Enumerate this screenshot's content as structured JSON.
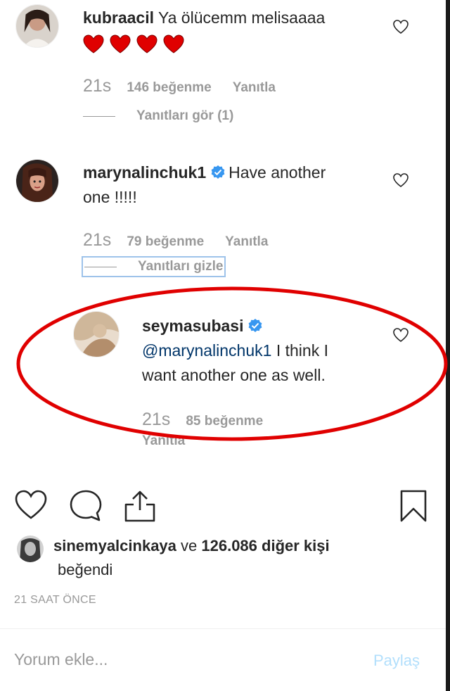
{
  "comments": [
    {
      "username": "kubraacil",
      "text": "Ya ölücemm melisaaaa",
      "verified": false,
      "emoji": "red-heart x4",
      "time": "21s",
      "likes": "146 beğenme",
      "reply_label": "Yanıtla",
      "replies_toggle": "Yanıtları gör (1)"
    },
    {
      "username": "marynalinchuk1",
      "text_line1": "Have another",
      "text_line2": "one !!!!!",
      "verified": true,
      "time": "21s",
      "likes": "79 beğenme",
      "reply_label": "Yanıtla",
      "replies_toggle": "Yanıtları gizle"
    },
    {
      "username": "seymasubasi",
      "mention": "@marynalinchuk1",
      "text_line1": " I think I",
      "text_line2": "want another one as well.",
      "verified": true,
      "time": "21s",
      "likes": "85 beğenme",
      "reply_label": "Yanıtla"
    }
  ],
  "liked_by": {
    "user": "sinemyalcinkaya",
    "connector": " ve ",
    "others": "126.086 diğer kişi",
    "suffix": "beğendi"
  },
  "timestamp": "21 SAAT ÖNCE",
  "comment_input": {
    "placeholder": "Yorum ekle..."
  },
  "post_button": "Paylaş",
  "colors": {
    "text": "#262626",
    "secondary": "#999999",
    "verified": "#3897f0",
    "highlight": "#e00000",
    "post_disabled": "#b2dffc"
  },
  "icons": [
    "heart-outline-icon",
    "comment-icon",
    "share-icon",
    "bookmark-icon",
    "verified-badge-icon"
  ]
}
